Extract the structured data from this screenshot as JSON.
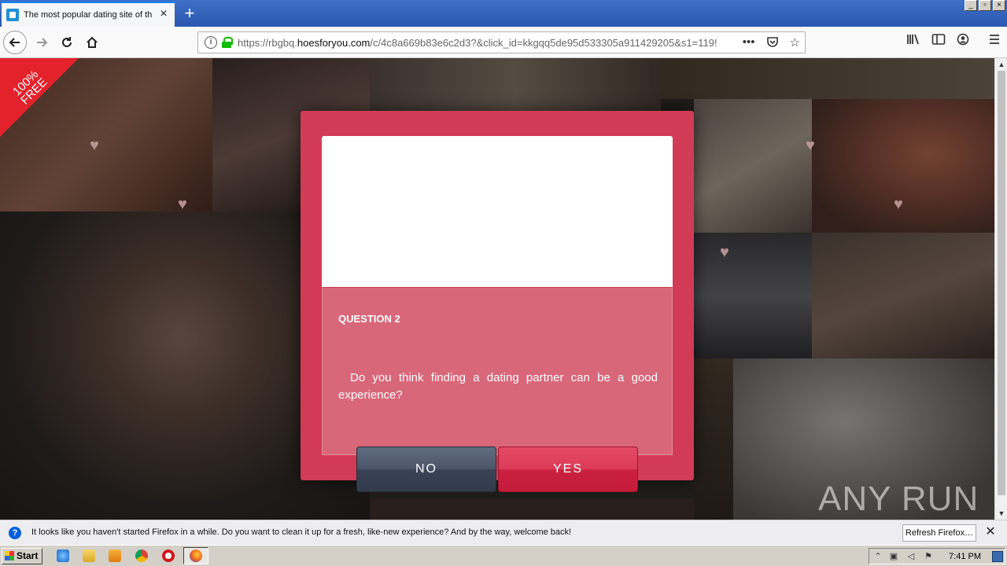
{
  "browser": {
    "tab_title": "The most popular dating site of th",
    "new_tab": "+",
    "window_controls": [
      "_",
      "▫",
      "×"
    ],
    "url_host_prefix": "https://rbgbq.",
    "url_host": "hoesforyou.com",
    "url_path": "/c/4c8a669b83e6c2d3?&click_id=kkgqq5de95d533305a911429205&s1=119!"
  },
  "page": {
    "badge": "100% FREE",
    "modal": {
      "question_label": "QUESTION 2",
      "question_text": "Do you think finding a dating partner can be a good experience?",
      "no_label": "NO",
      "yes_label": "YES"
    },
    "watermark": "ANY RUN"
  },
  "notification": {
    "text": "It looks like you haven't started Firefox in a while. Do you want to clean it up for a fresh, like-new experience? And by the way, welcome back!",
    "button": "Refresh Firefox…"
  },
  "taskbar": {
    "start": "Start",
    "time": "7:41 PM"
  }
}
